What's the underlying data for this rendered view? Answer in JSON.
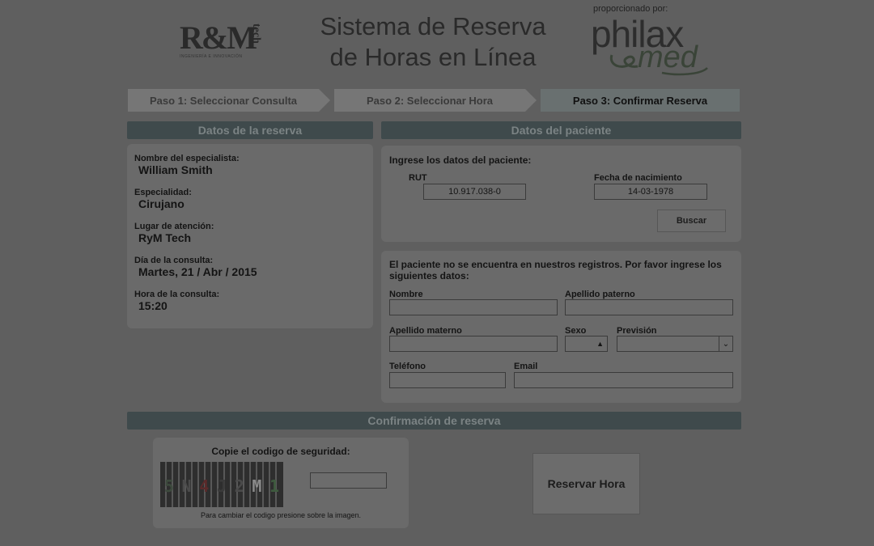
{
  "header": {
    "logo_left_main": "R&M",
    "logo_left_tech": "tech",
    "logo_left_sub": "INGENIERÍA E INNOVACIÓN",
    "title_line1": "Sistema de Reserva",
    "title_line2": "de Horas en Línea",
    "powered_by": "proporcionado por:",
    "logo_right_top": "philax",
    "logo_right_bottom": "med"
  },
  "steps": [
    {
      "label": "Paso 1: Seleccionar Consulta",
      "active": false
    },
    {
      "label": "Paso 2: Seleccionar Hora",
      "active": false
    },
    {
      "label": "Paso 3: Confirmar Reserva",
      "active": true
    }
  ],
  "reservation": {
    "title": "Datos de la reserva",
    "fields": [
      {
        "label": "Nombre del especialista:",
        "value": "William Smith"
      },
      {
        "label": "Especialidad:",
        "value": "Cirujano"
      },
      {
        "label": "Lugar de atención:",
        "value": "RyM Tech"
      },
      {
        "label": "Día de la consulta:",
        "value": "Martes, 21 / Abr / 2015"
      },
      {
        "label": "Hora de la consulta:",
        "value": "15:20"
      }
    ]
  },
  "patient": {
    "title": "Datos del paciente",
    "search_prompt": "Ingrese los datos del paciente:",
    "rut_label": "RUT",
    "rut_value": "10.917.038-0",
    "dob_label": "Fecha de nacimiento",
    "dob_value": "14-03-1978",
    "search_button": "Buscar",
    "not_found_msg": "El paciente no se encuentra en nuestros registros. Por favor ingrese los siguientes datos:",
    "nombre_label": "Nombre",
    "apellido_paterno_label": "Apellido paterno",
    "apellido_materno_label": "Apellido materno",
    "sexo_label": "Sexo",
    "prevision_label": "Previsión",
    "telefono_label": "Teléfono",
    "email_label": "Email"
  },
  "confirmation": {
    "title": "Confirmación de reserva",
    "captcha_prompt": "Copie el codigo de seguridad:",
    "captcha_chars": [
      "5",
      "N",
      "4",
      "J",
      "2",
      "M",
      "1"
    ],
    "captcha_colors": [
      "#3d4a3d",
      "#4a4a4a",
      "#5a2a2a",
      "#3a3a3a",
      "#4a4a4a",
      "#8a8a8a",
      "#3e5a3e"
    ],
    "captcha_hint": "Para cambiar el codigo presione sobre la imagen.",
    "reserve_button": "Reservar Hora"
  }
}
